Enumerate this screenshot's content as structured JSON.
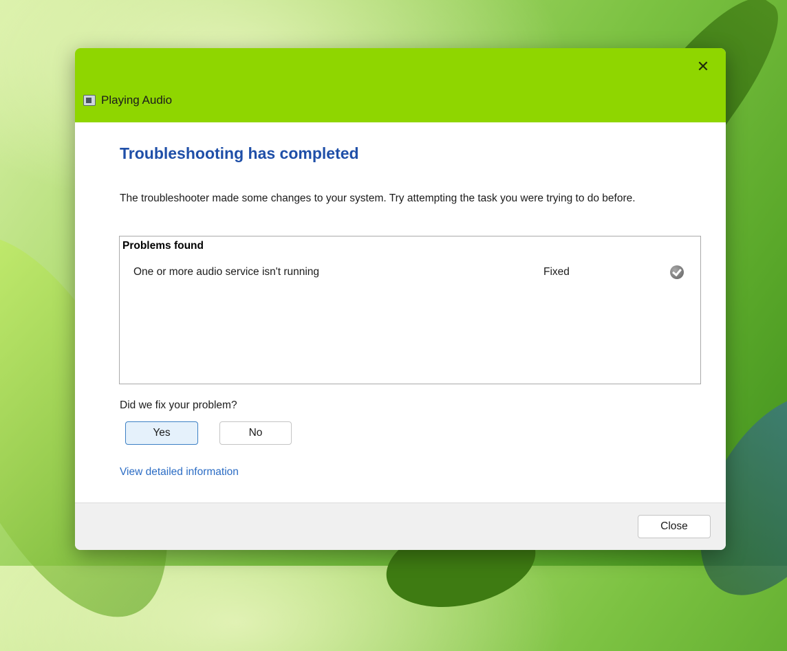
{
  "window": {
    "title": "Playing Audio",
    "close_glyph": "✕"
  },
  "content": {
    "heading": "Troubleshooting has completed",
    "description": "The troubleshooter made some changes to your system. Try attempting the task you were trying to do before."
  },
  "problems": {
    "header": "Problems found",
    "items": [
      {
        "name": "One or more audio service isn't running",
        "status": "Fixed",
        "icon": "check-circle-icon"
      }
    ]
  },
  "feedback": {
    "question": "Did we fix your problem?",
    "yes_label": "Yes",
    "no_label": "No"
  },
  "details_link": "View detailed information",
  "footer": {
    "close_label": "Close"
  },
  "colors": {
    "titlebar": "#8fd600",
    "heading": "#1f4fa8",
    "link": "#2b6cc4"
  }
}
